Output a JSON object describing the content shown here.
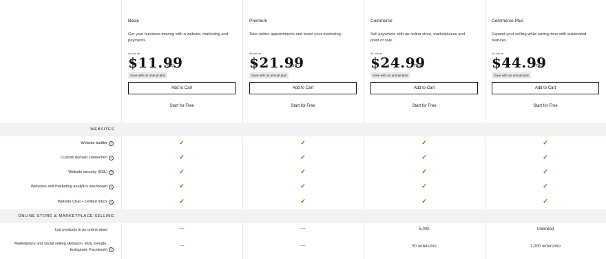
{
  "plans": [
    {
      "name": "Basic",
      "desc": "Get your business moving with a website, marketing and payments.",
      "as_low": "As low as",
      "price": "$11.99",
      "per": "/mo",
      "save": "Save with an annual plan",
      "cart": "Add to Cart",
      "free": "Start for Free"
    },
    {
      "name": "Premium",
      "desc": "Take online appointments and boost your marketing.",
      "as_low": "As low as",
      "price": "$21.99",
      "per": "/mo",
      "save": "Save with an annual plan",
      "cart": "Add to Cart",
      "free": "Start for Free"
    },
    {
      "name": "Commerce",
      "desc": "Sell anywhere with an online store, marketplaces and point of sale.",
      "as_low": "As low as",
      "price": "$24.99",
      "per": "/mo",
      "save": "Save with an annual plan",
      "cart": "Add to Cart",
      "free": "Start for Free"
    },
    {
      "name": "Commerce Plus",
      "desc": "Expand your selling while saving time with automated features.",
      "as_low": "As low as",
      "price": "$44.99",
      "per": "/mo",
      "save": "Save with an annual plan",
      "cart": "Add to Cart",
      "free": "Start for Free"
    }
  ],
  "sections": {
    "websites": "Websites",
    "store": "Online Store & Marketplace Selling"
  },
  "features": {
    "website_builder": "Website builder",
    "custom_domain": "Custom domain connection",
    "security": "Website security (SSL)",
    "analytics": "Websites and marketing analytics dashboard",
    "chat": "Website Chat + Unified Inbox",
    "products_line": "List products in an online store",
    "marketplace_line1": "Marketplace and social selling (Amazon, Etsy, Google,",
    "marketplace_line2": "Instagram, Facebook)"
  },
  "icons": {
    "check": "checkmark-icon",
    "help": "question-circle-icon"
  },
  "glyphs": {
    "check": "✓",
    "dash": "—",
    "help": "?"
  },
  "values": {
    "products": [
      "—",
      "—",
      "5,000",
      "Unlimited"
    ],
    "marketplace": [
      "—",
      "—",
      "50 orders/mo",
      "1,000 orders/mo"
    ]
  },
  "colors": {
    "check": "#3d8a1a",
    "band": "#f2f2f2",
    "badge": "#e9e9e9"
  }
}
